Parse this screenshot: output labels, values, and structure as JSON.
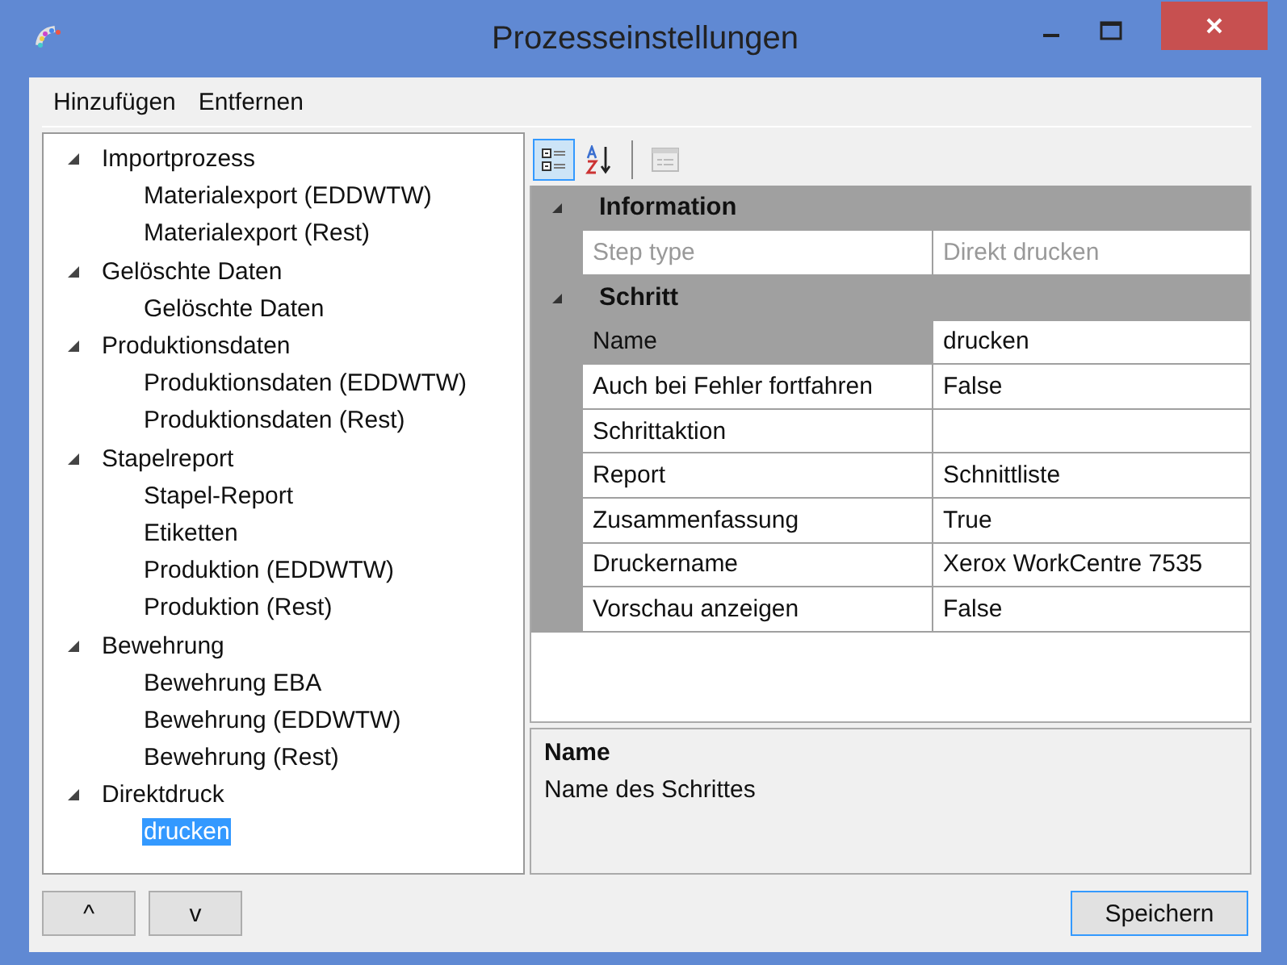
{
  "window": {
    "title": "Prozesseinstellungen"
  },
  "menu": [
    "Hinzufügen",
    "Entfernen"
  ],
  "tree": [
    {
      "label": "Importprozess",
      "expanded": true,
      "children": [
        {
          "label": "Materialexport (EDDWTW)",
          "selected": false
        },
        {
          "label": "Materialexport (Rest)",
          "selected": false
        }
      ]
    },
    {
      "label": "Gelöschte Daten",
      "expanded": true,
      "children": [
        {
          "label": "Gelöschte Daten",
          "selected": false
        }
      ]
    },
    {
      "label": "Produktionsdaten",
      "expanded": true,
      "children": [
        {
          "label": "Produktionsdaten (EDDWTW)",
          "selected": false
        },
        {
          "label": "Produktionsdaten (Rest)",
          "selected": false
        }
      ]
    },
    {
      "label": "Stapelreport",
      "expanded": true,
      "children": [
        {
          "label": "Stapel-Report",
          "selected": false
        },
        {
          "label": "Etiketten",
          "selected": false
        },
        {
          "label": "Produktion (EDDWTW)",
          "selected": false
        },
        {
          "label": "Produktion (Rest)",
          "selected": false
        }
      ]
    },
    {
      "label": "Bewehrung",
      "expanded": true,
      "children": [
        {
          "label": "Bewehrung EBA",
          "selected": false
        },
        {
          "label": "Bewehrung (EDDWTW)",
          "selected": false
        },
        {
          "label": "Bewehrung (Rest)",
          "selected": false
        }
      ]
    },
    {
      "label": "Direktdruck",
      "expanded": true,
      "children": [
        {
          "label": "drucken",
          "selected": true
        }
      ]
    }
  ],
  "toolbar": [
    {
      "kind": "categorized",
      "selected": true
    },
    {
      "kind": "alphabetical",
      "selected": false
    },
    {
      "kind": "property-pages",
      "disabled": true
    }
  ],
  "property_grid": [
    {
      "name": "Information",
      "expanded": true,
      "properties": [
        {
          "name": "Step type",
          "value": "Direkt drucken",
          "disabled": true,
          "selected": false
        }
      ]
    },
    {
      "name": "Schritt",
      "expanded": true,
      "properties": [
        {
          "name": "Name",
          "value": "drucken",
          "disabled": false,
          "selected": true
        },
        {
          "name": "Auch bei Fehler fortfahren",
          "value": "False",
          "disabled": false,
          "selected": false
        },
        {
          "name": "Schrittaktion",
          "disabled": false,
          "selected": false
        },
        {
          "name": "Report",
          "value": "Schnittliste",
          "disabled": false,
          "selected": false
        },
        {
          "name": "Zusammenfassung",
          "value": "True",
          "disabled": false,
          "selected": false
        },
        {
          "name": "Druckername",
          "value": "Xerox WorkCentre 7535",
          "disabled": false,
          "selected": false
        },
        {
          "name": "Vorschau anzeigen",
          "value": "False",
          "disabled": false,
          "selected": false
        }
      ]
    }
  ],
  "description": {
    "title": "Name",
    "text": "Name des Schrittes"
  },
  "move_buttons": [
    "^",
    "v"
  ],
  "save_button": {
    "label": "Speichern",
    "default": true
  }
}
